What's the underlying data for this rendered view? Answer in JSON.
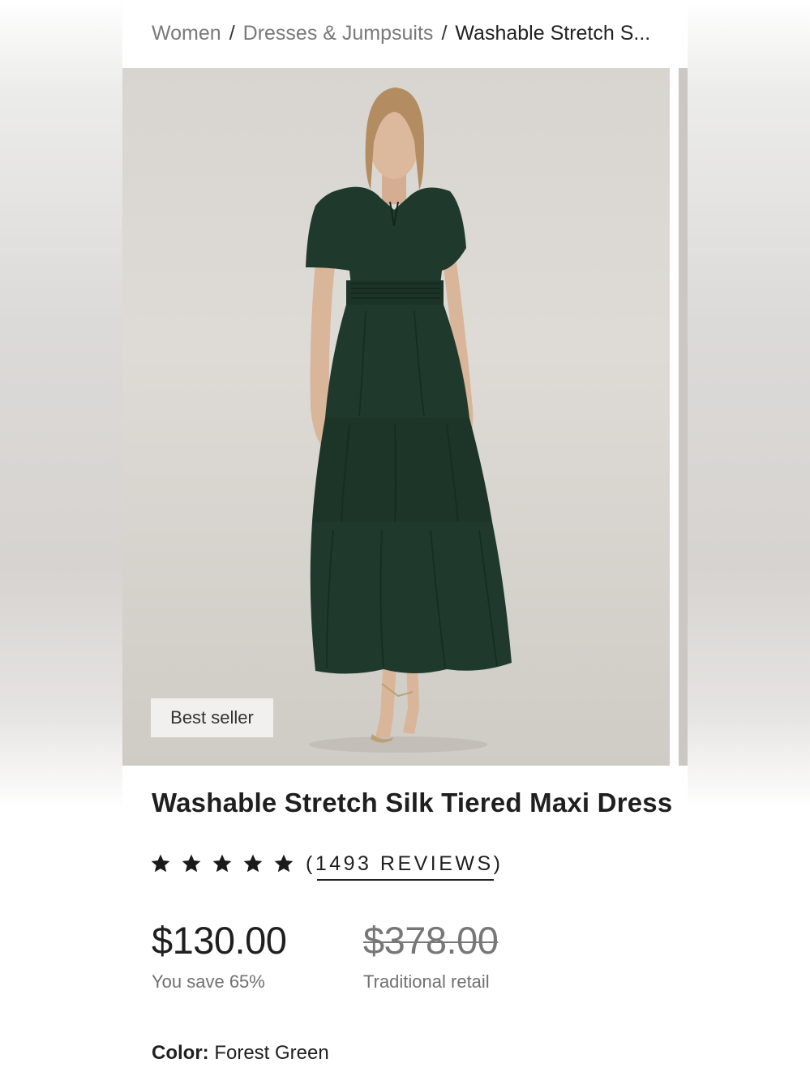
{
  "breadcrumb": {
    "items": [
      "Women",
      "Dresses & Jumpsuits",
      "Washable Stretch S..."
    ],
    "separator": "/"
  },
  "gallery": {
    "badge": "Best seller"
  },
  "product": {
    "title": "Washable Stretch Silk Tiered Maxi Dress",
    "rating": {
      "stars": 5,
      "reviews_label": "(1493 REVIEWS)"
    },
    "price": "$130.00",
    "save_text": "You save 65%",
    "retail_price": "$378.00",
    "retail_label": "Traditional retail",
    "color_label": "Color:",
    "color_value": "Forest Green"
  },
  "colors": {
    "dress": "#1f3a2c",
    "text": "#1f1f1f",
    "muted": "#707070"
  }
}
